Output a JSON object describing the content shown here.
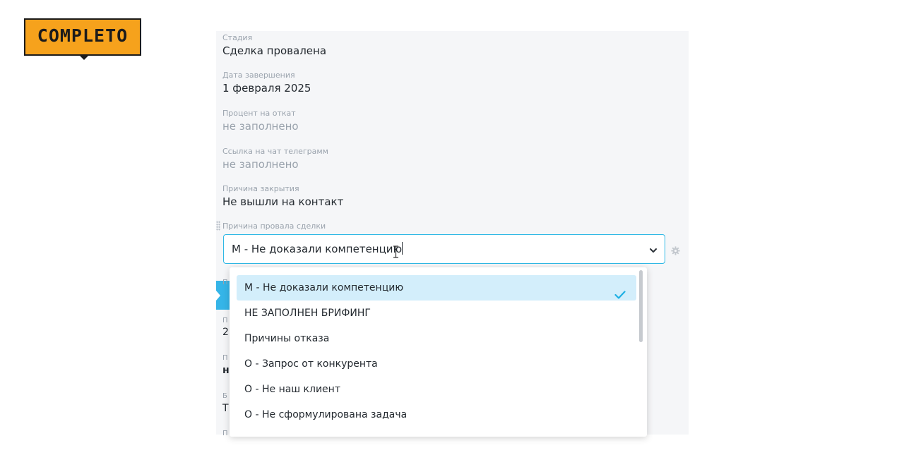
{
  "logo": {
    "text": "COMPLETO"
  },
  "fields": [
    {
      "label": "Стадия",
      "value": "Сделка провалена",
      "empty": false
    },
    {
      "label": "Дата завершения",
      "value": "1 февраля 2025",
      "empty": false
    },
    {
      "label": "Процент на откат",
      "value": "не заполнено",
      "empty": true
    },
    {
      "label": "Ссылка на чат телеграмм",
      "value": "не заполнено",
      "empty": true
    },
    {
      "label": "Причина закрытия",
      "value": "Не вышли на контакт",
      "empty": false
    }
  ],
  "fail_reason": {
    "label": "Причина провала сделки",
    "value": "М - Не доказали компетенцию"
  },
  "hidden_field_stubs": [
    {
      "text": "П",
      "kind": "label"
    },
    {
      "text": "П",
      "kind": "label"
    },
    {
      "text": "2",
      "kind": "value"
    },
    {
      "text": "П",
      "kind": "label"
    },
    {
      "text": "н",
      "kind": "value"
    },
    {
      "text": "Б",
      "kind": "label"
    },
    {
      "text": "Т",
      "kind": "value"
    },
    {
      "text": "П",
      "kind": "label"
    }
  ],
  "dropdown": {
    "options": [
      {
        "label": "М - Не доказали компетенцию",
        "selected": true
      },
      {
        "label": "НЕ ЗАПОЛНЕН БРИФИНГ",
        "selected": false
      },
      {
        "label": "Причины отказа",
        "selected": false
      },
      {
        "label": "О - Запрос от конкурента",
        "selected": false
      },
      {
        "label": "О - Не наш клиент",
        "selected": false
      },
      {
        "label": "О - Не сформулирована задача",
        "selected": false
      }
    ]
  },
  "colors": {
    "accent": "#2fb8e5",
    "selected_bg": "#d3eefb",
    "check": "#1fb0e3",
    "logo_bg": "#f6a21c"
  },
  "icons": {
    "select_chevron": "chevron-down-icon",
    "selected_check": "check-icon",
    "field_settings": "gear-icon",
    "cursor": "text-cursor-icon",
    "drag": "drag-handle-icon"
  }
}
